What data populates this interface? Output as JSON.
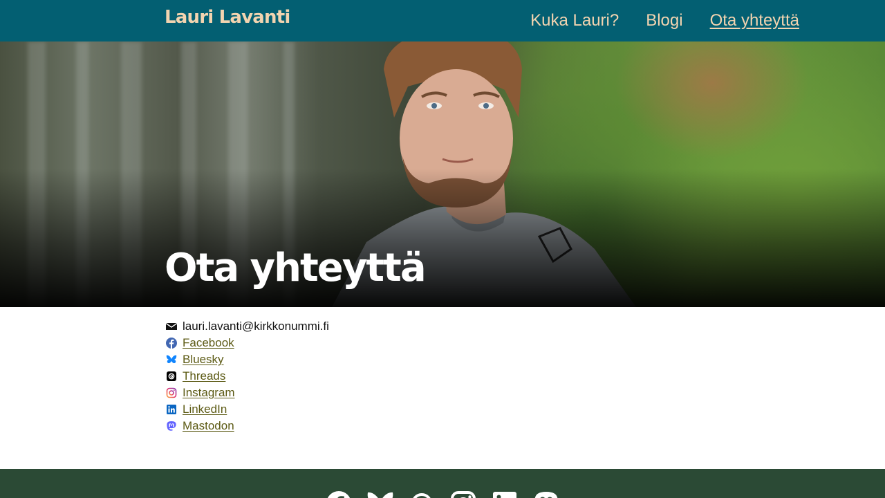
{
  "header": {
    "site_title": "Lauri Lavanti",
    "nav": [
      {
        "label": "Kuka Lauri?"
      },
      {
        "label": "Blogi"
      },
      {
        "label": "Ota yhteyttä",
        "active": true
      }
    ]
  },
  "hero": {
    "title": "Ota yhteyttä"
  },
  "contacts": {
    "email": {
      "icon": "envelope-icon",
      "text": "lauri.lavanti@kirkkonummi.fi"
    },
    "links": [
      {
        "icon": "facebook-icon",
        "label": "Facebook"
      },
      {
        "icon": "bluesky-icon",
        "label": "Bluesky"
      },
      {
        "icon": "threads-icon",
        "label": "Threads"
      },
      {
        "icon": "instagram-icon",
        "label": "Instagram"
      },
      {
        "icon": "linkedin-icon",
        "label": "LinkedIn"
      },
      {
        "icon": "mastodon-icon",
        "label": "Mastodon"
      }
    ]
  },
  "footer": {
    "icons": [
      "facebook-icon",
      "bluesky-icon",
      "threads-icon",
      "instagram-icon",
      "linkedin-icon",
      "mastodon-icon"
    ]
  },
  "colors": {
    "header_bg": "#035f72",
    "header_text": "#f3d4b0",
    "link": "#5c5a14",
    "footer_bg": "#2b4a35",
    "facebook": "#4267b2",
    "bluesky": "#1185fe",
    "linkedin": "#0a66c2",
    "mastodon": "#6364ff"
  }
}
